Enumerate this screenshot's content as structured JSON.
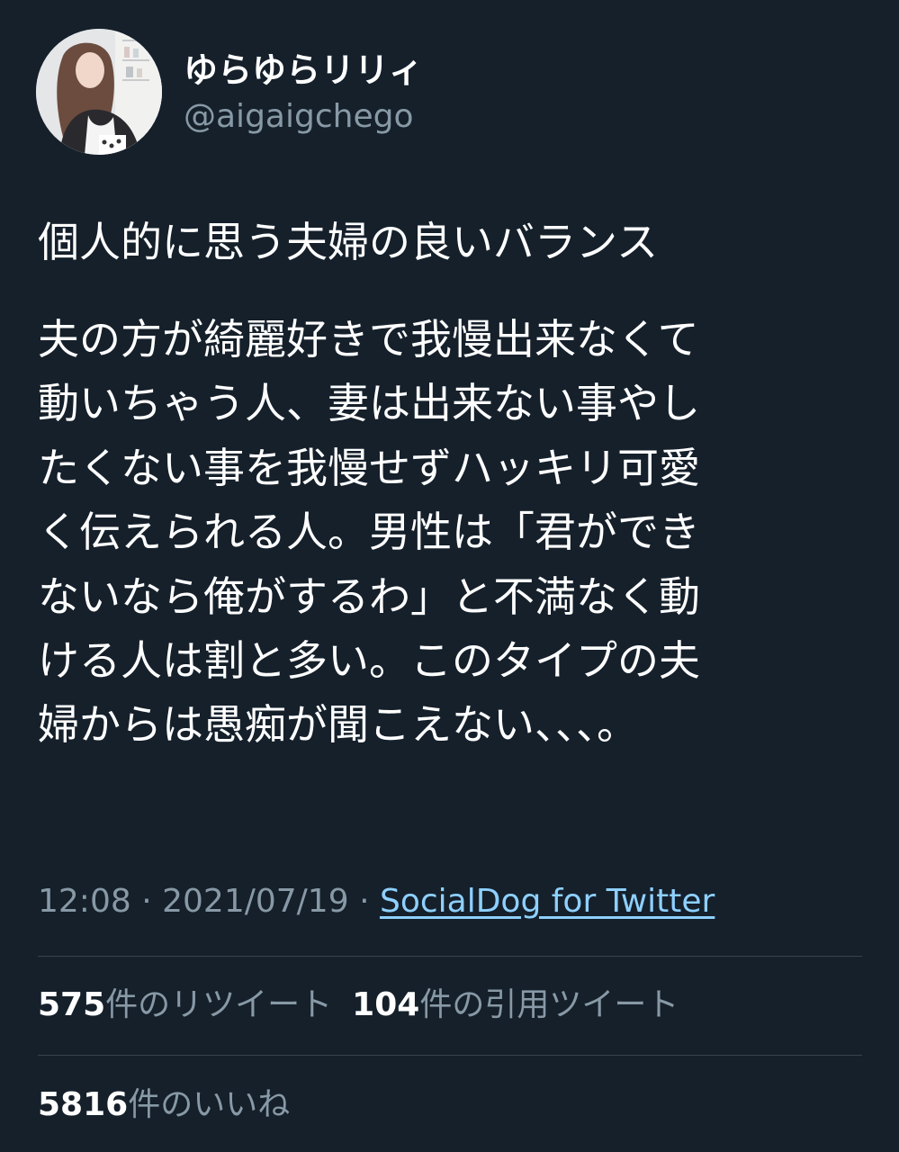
{
  "user": {
    "display_name": "ゆらゆらリリィ",
    "handle": "@aigaigchego"
  },
  "tweet": {
    "lead": "個人的に思う夫婦の良いバランス",
    "body_lines": [
      "夫の方が綺麗好きで我慢出来なくて",
      "動いちゃう人、妻は出来ない事やし",
      "たくない事を我慢せずハッキリ可愛",
      "く伝えられる人。男性は「君ができ",
      "ないなら俺がするわ」と不満なく動",
      "ける人は割と多い。このタイプの夫",
      "婦からは愚痴が聞こえない、、、。"
    ],
    "time": "12:08",
    "separator": "·",
    "date": "2021/07/19",
    "source": "SocialDog for Twitter"
  },
  "stats": {
    "retweets_count": "575",
    "retweets_label": "件のリツイート",
    "quotes_count": "104",
    "quotes_label": "件の引用ツイート",
    "likes_count": "5816",
    "likes_label": "件のいいね"
  },
  "colors": {
    "background": "#15202b",
    "text_primary": "#ffffff",
    "text_secondary": "#8899a6",
    "link": "#8ed0ff",
    "divider": "#38444d"
  },
  "icons": {
    "avatar": "profile-photo"
  }
}
